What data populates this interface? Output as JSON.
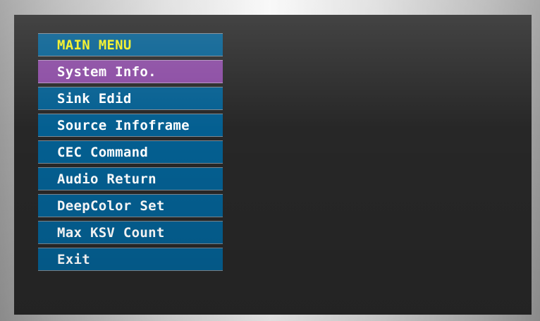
{
  "menu": {
    "title": "MAIN MENU",
    "items": [
      {
        "label": "System Info."
      },
      {
        "label": "Sink Edid"
      },
      {
        "label": "Source Infoframe"
      },
      {
        "label": "CEC Command"
      },
      {
        "label": "Audio Return"
      },
      {
        "label": "DeepColor Set"
      },
      {
        "label": "Max KSV Count"
      },
      {
        "label": "Exit"
      }
    ],
    "selected_index": 0
  },
  "colors": {
    "screen_background": "#272727",
    "item_background": "#045f91",
    "selected_background": "#8a4aa2",
    "title_text": "#f2ef1e",
    "item_text": "#ffffff"
  }
}
